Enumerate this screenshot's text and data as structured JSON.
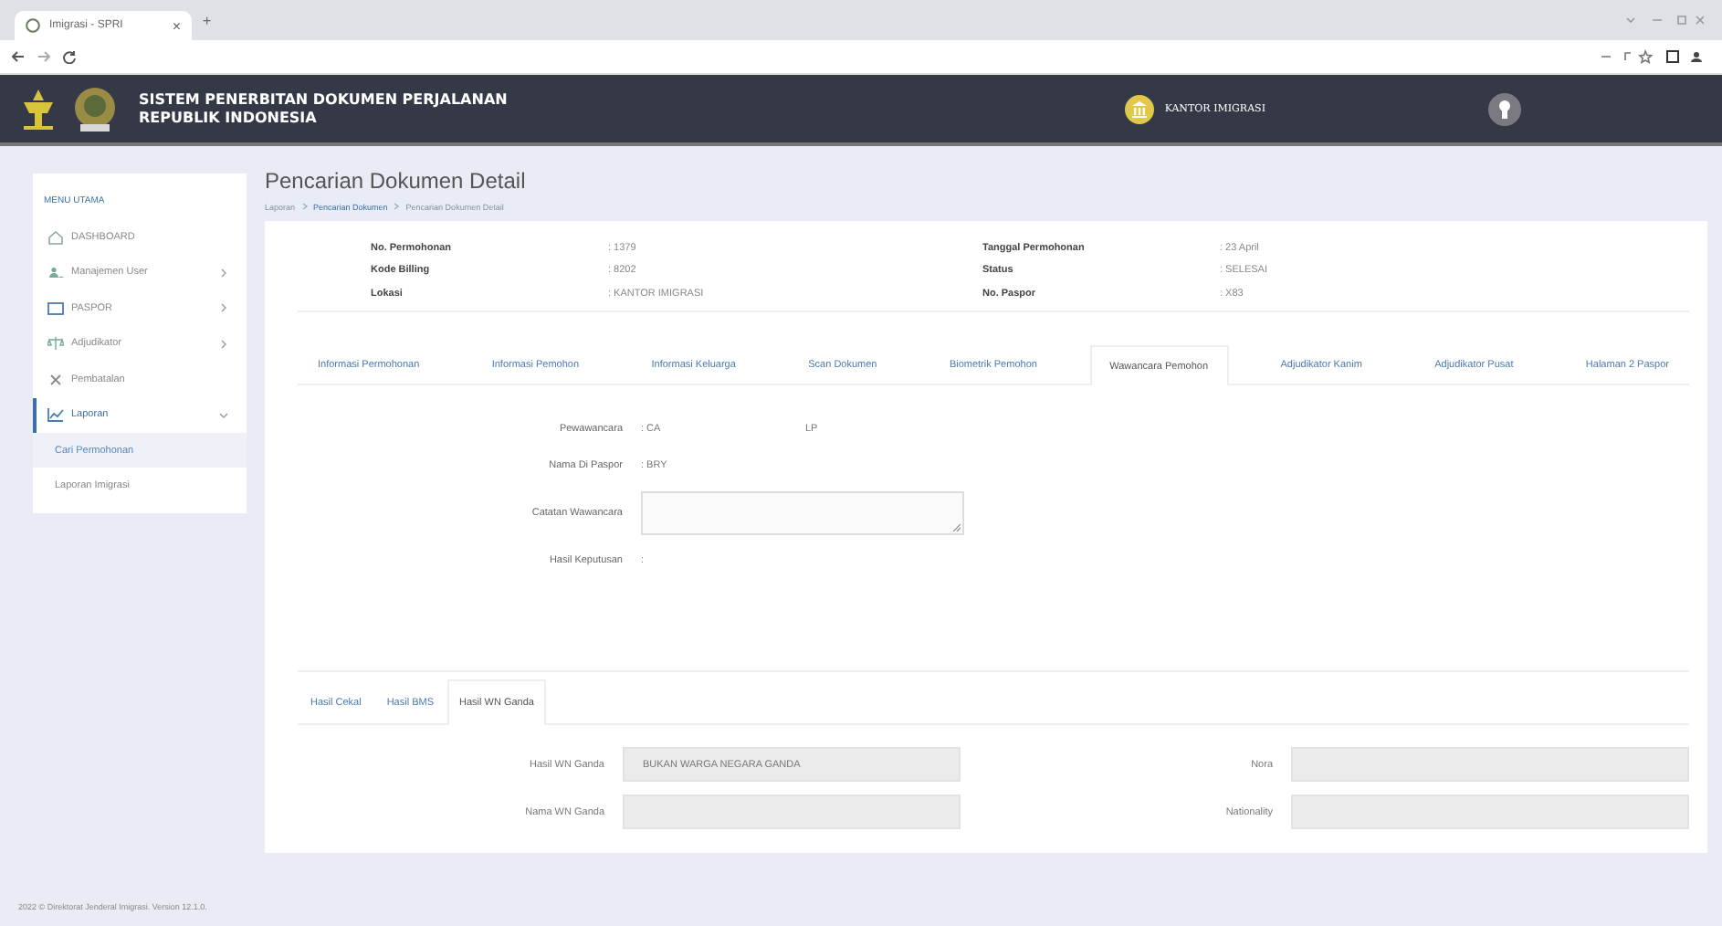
{
  "browser": {
    "tab_title": "Imigrasi - SPRI",
    "tab_close": "×",
    "new_tab": "+"
  },
  "header": {
    "title_lines": [
      "SISTEM PENERBITAN DOKUMEN PERJALANAN",
      "REPUBLIK INDONESIA"
    ],
    "office": "KANTOR IMIGRASI"
  },
  "sidebar": {
    "heading": "MENU UTAMA",
    "items": [
      {
        "label": "DASHBOARD",
        "kind": "link",
        "selected": false
      },
      {
        "label": "Manajemen User",
        "kind": "menu",
        "expanded": false,
        "selected": false
      },
      {
        "label": "PASPOR",
        "kind": "menu",
        "expanded": false,
        "selected": false
      },
      {
        "label": "Adjudikator",
        "kind": "menu",
        "expanded": false,
        "selected": false
      },
      {
        "label": "Pembatalan",
        "kind": "link",
        "selected": false
      },
      {
        "label": "Laporan",
        "kind": "menu",
        "expanded": true,
        "selected": true,
        "children": [
          {
            "label": "Cari Permohonan",
            "selected": true
          },
          {
            "label": "Laporan Imigrasi",
            "selected": false
          }
        ]
      }
    ]
  },
  "page": {
    "title": "Pencarian Dokumen Detail",
    "breadcrumb": [
      "Laporan",
      "Pencarian Dokumen",
      "Pencarian Dokumen Detail"
    ]
  },
  "info": {
    "left": [
      {
        "label": "No. Permohonan",
        "value": ": 1379"
      },
      {
        "label": "Kode Billing",
        "value": ": 8202"
      },
      {
        "label": "Lokasi",
        "value": ": KANTOR IMIGRASI"
      }
    ],
    "right": [
      {
        "label": "Tanggal Permohonan",
        "value": ": 23 April"
      },
      {
        "label": "Status",
        "value": ": SELESAI"
      },
      {
        "label": "No. Paspor",
        "value": ": X83"
      }
    ]
  },
  "tabs": [
    {
      "label": "Informasi Permohonan",
      "selected": false
    },
    {
      "label": "Informasi Pemohon",
      "selected": false
    },
    {
      "label": "Informasi Keluarga",
      "selected": false
    },
    {
      "label": "Scan Dokumen",
      "selected": false
    },
    {
      "label": "Biometrik Pemohon",
      "selected": false
    },
    {
      "label": "Wawancara Pemohon",
      "selected": true
    },
    {
      "label": "Adjudikator Kanim",
      "selected": false
    },
    {
      "label": "Adjudikator Pusat",
      "selected": false
    },
    {
      "label": "Halaman 2 Paspor",
      "selected": false
    }
  ],
  "interview": [
    {
      "kind": "text",
      "label": "Pewawancara",
      "value": ": CA",
      "extra": "LP"
    },
    {
      "kind": "text",
      "label": "Nama Di Paspor",
      "value": ": BRY"
    },
    {
      "kind": "textarea",
      "label": "Catatan Wawancara"
    },
    {
      "kind": "text",
      "label": "Hasil Keputusan",
      "value": ":"
    }
  ],
  "subtabs": [
    {
      "label": "Hasil Cekal",
      "selected": false
    },
    {
      "label": "Hasil BMS",
      "selected": false
    },
    {
      "label": "Hasil WN Ganda",
      "selected": true
    }
  ],
  "ganda_fields": [
    {
      "label": "Hasil WN Ganda",
      "value": "BUKAN WARGA NEGARA GANDA"
    },
    {
      "label": "Nora"
    },
    {
      "label": "Nama WN Ganda"
    },
    {
      "label": "Nationality"
    }
  ],
  "footer": "2022 © Direktorat Jenderal Imigrasi. Version 12.1.0."
}
